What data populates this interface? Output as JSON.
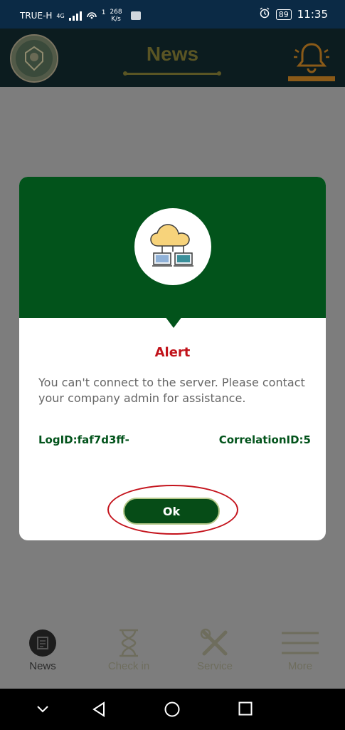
{
  "status_bar": {
    "carrier": "TRUE-H",
    "network_type": "4G",
    "data_indicator": "1",
    "speed_value": "268",
    "speed_unit": "K/s",
    "battery": "89",
    "time": "11:35",
    "icons": [
      "signal-icon",
      "wifi-hotspot-icon",
      "sim-icon",
      "alarm-icon",
      "battery-icon"
    ]
  },
  "app_bar": {
    "title": "News",
    "icons": [
      "org-logo",
      "bell-icon"
    ]
  },
  "dialog": {
    "title": "Alert",
    "message": "You can't connect to the server. Please contact your company admin for assistance.",
    "log_id": "LogID:faf7d3ff-",
    "correlation_id": "CorrelationID:5",
    "ok_label": "Ok",
    "icon": "cloud-network-icon",
    "header_color": "#02531b",
    "title_color": "#c1121a"
  },
  "tab_bar": {
    "items": [
      {
        "label": "News",
        "icon": "news-icon",
        "active": true
      },
      {
        "label": "Check in",
        "icon": "hourglass-icon",
        "active": false
      },
      {
        "label": "Service",
        "icon": "tools-icon",
        "active": false
      },
      {
        "label": "More",
        "icon": "menu-icon",
        "active": false
      }
    ]
  },
  "nav_bar": {
    "icons": [
      "nav-down-icon",
      "back-icon",
      "home-icon",
      "recents-icon"
    ]
  }
}
